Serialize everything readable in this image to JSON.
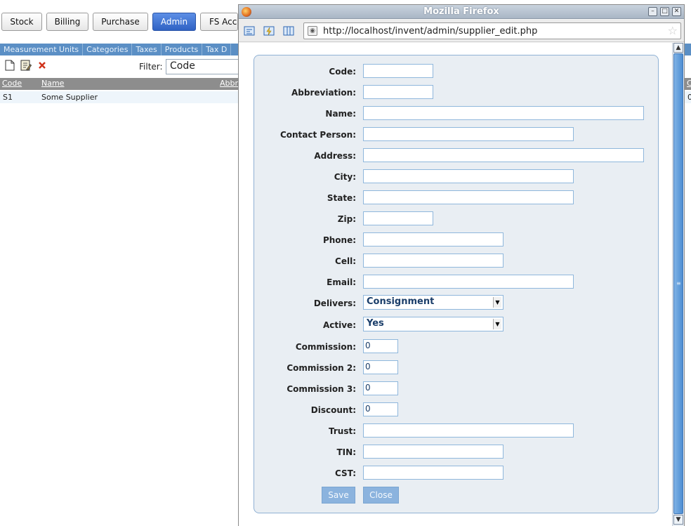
{
  "bg": {
    "tabs": [
      "Stock",
      "Billing",
      "Purchase",
      "Admin",
      "FS Acco"
    ],
    "subnav": [
      "Measurement Units",
      "Categories",
      "Taxes",
      "Products",
      "Tax D"
    ],
    "filter_label": "Filter:",
    "filter_value": "Code",
    "table": {
      "headers": [
        "Code",
        "Name",
        "Abbr"
      ],
      "right_edge_header": "C",
      "rows": [
        {
          "code": "S1",
          "name": "Some Supplier",
          "right_edge": "0"
        }
      ]
    }
  },
  "browser": {
    "title": "Mozilla Firefox",
    "url": "http://localhost/invent/admin/supplier_edit.php"
  },
  "form": {
    "labels": {
      "code": "Code:",
      "abbreviation": "Abbreviation:",
      "name": "Name:",
      "contact_person": "Contact Person:",
      "address": "Address:",
      "city": "City:",
      "state": "State:",
      "zip": "Zip:",
      "phone": "Phone:",
      "cell": "Cell:",
      "email": "Email:",
      "delivers": "Delivers:",
      "active": "Active:",
      "commission": "Commission:",
      "commission2": "Commission 2:",
      "commission3": "Commission 3:",
      "discount": "Discount:",
      "trust": "Trust:",
      "tin": "TIN:",
      "cst": "CST:"
    },
    "values": {
      "code": "",
      "abbreviation": "",
      "name": "",
      "contact_person": "",
      "address": "",
      "city": "",
      "state": "",
      "zip": "",
      "phone": "",
      "cell": "",
      "email": "",
      "delivers": "Consignment",
      "active": "Yes",
      "commission": "0",
      "commission2": "0",
      "commission3": "0",
      "discount": "0",
      "trust": "",
      "tin": "",
      "cst": ""
    },
    "buttons": {
      "save": "Save",
      "close": "Close"
    }
  }
}
